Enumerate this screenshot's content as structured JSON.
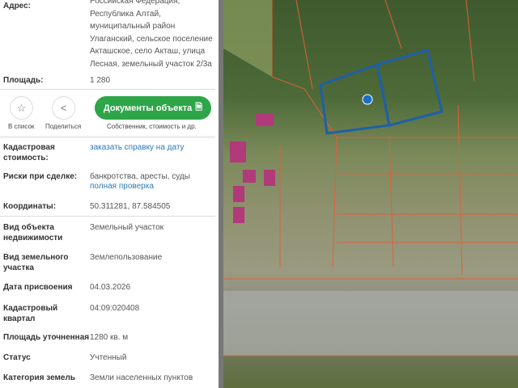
{
  "address": {
    "label": "Адрес:",
    "value": "Российская Федерация, Республика Алтай, муниципальный район Улаганский, сельское поселение Акташское, село Акташ, улица Лесная, земельный участок 2/3а"
  },
  "area": {
    "label": "Площадь:",
    "value": "1 280"
  },
  "actions": {
    "favorite": "В список",
    "share": "Поделиться",
    "documents": "Документы объекта",
    "documents_sub": "Собственник, стоимость и др."
  },
  "props": [
    {
      "label": "Кадастровая стоимость:",
      "value": "заказать справку на дату"
    },
    {
      "label": "Риски при сделке:",
      "value": "банкротства, аресты, суды",
      "link": "полная проверка"
    },
    {
      "label": "Координаты:",
      "value": "50.311281, 87.584505"
    },
    {
      "label": "Вид объекта недвижимости",
      "value": "Земельный участок"
    },
    {
      "label": "Вид земельного участка",
      "value": "Землепользование"
    },
    {
      "label": "Дата присвоения",
      "value": "04.03.2026"
    },
    {
      "label": "Кадастровый квартал",
      "value": "04:09:020408"
    },
    {
      "label": "Площадь уточненная",
      "value": "1280 кв. м"
    },
    {
      "label": "Статус",
      "value": "Учтенный"
    },
    {
      "label": "Категория земель",
      "value": "Земли населенных пунктов"
    }
  ],
  "colors": {
    "accent": "#2da548",
    "link": "#2a7ab8",
    "parcel": "#1f5fa8",
    "boundary": "#e0603a"
  }
}
